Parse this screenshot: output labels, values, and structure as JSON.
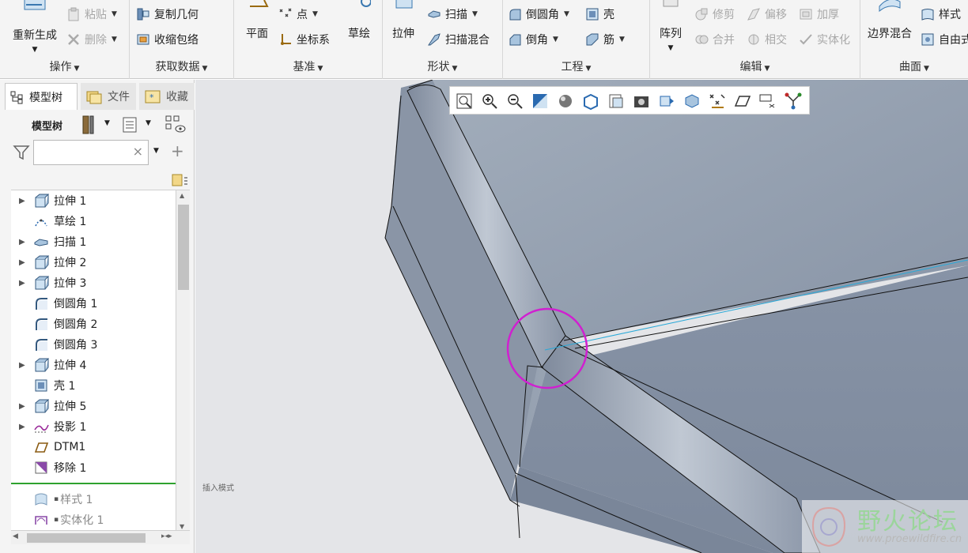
{
  "ribbon": {
    "operations": {
      "regenerate": "重新生成",
      "paste": "粘贴",
      "delete": "删除",
      "group_label": "操作"
    },
    "get_data": {
      "copy_geometry": "复制几何",
      "shrinkwrap": "收缩包络",
      "group_label": "获取数据"
    },
    "datum": {
      "plane": "平面",
      "point": "点",
      "csys": "坐标系",
      "sketch": "草绘",
      "group_label": "基准"
    },
    "shapes": {
      "extrude": "拉伸",
      "sweep": "扫描",
      "swept_blend": "扫描混合",
      "group_label": "形状"
    },
    "engineering": {
      "round": "倒圆角",
      "chamfer": "倒角",
      "shell": "壳",
      "rib": "筋",
      "group_label": "工程"
    },
    "editing": {
      "pattern": "阵列",
      "trim": "修剪",
      "offset": "偏移",
      "thicken": "加厚",
      "merge": "合并",
      "intersect": "相交",
      "solidify": "实体化",
      "group_label": "编辑"
    },
    "surfaces": {
      "boundary_blend": "边界混合",
      "style": "样式",
      "freestyle": "自由式",
      "group_label": "曲面"
    }
  },
  "left_panel": {
    "tabs": [
      {
        "label": "模型树"
      },
      {
        "label": "文件"
      },
      {
        "label": "收藏"
      }
    ],
    "toolbar_label": "模型树",
    "search": {
      "value": "",
      "clear": "×",
      "add": "+"
    },
    "tree_items": [
      {
        "label": "拉伸 1",
        "icon": "extrude-icon",
        "expandable": true
      },
      {
        "label": "草绘 1",
        "icon": "sketch-icon",
        "expandable": false
      },
      {
        "label": "扫描 1",
        "icon": "sweep-icon",
        "expandable": true
      },
      {
        "label": "拉伸 2",
        "icon": "extrude-icon",
        "expandable": true
      },
      {
        "label": "拉伸 3",
        "icon": "extrude-icon",
        "expandable": true
      },
      {
        "label": "倒圆角 1",
        "icon": "round-icon",
        "expandable": false
      },
      {
        "label": "倒圆角 2",
        "icon": "round-icon",
        "expandable": false
      },
      {
        "label": "倒圆角 3",
        "icon": "round-icon",
        "expandable": false
      },
      {
        "label": "拉伸 4",
        "icon": "extrude-icon",
        "expandable": true
      },
      {
        "label": "壳 1",
        "icon": "shell-icon",
        "expandable": false
      },
      {
        "label": "拉伸 5",
        "icon": "extrude-icon",
        "expandable": true
      },
      {
        "label": "投影 1",
        "icon": "projection-icon",
        "expandable": true
      },
      {
        "label": "DTM1",
        "icon": "datum-plane-icon",
        "expandable": false
      },
      {
        "label": "移除 1",
        "icon": "remove-icon",
        "expandable": false
      }
    ],
    "after_insert_items": [
      {
        "label": "样式 1",
        "icon": "style-icon"
      },
      {
        "label": "实体化 1",
        "icon": "solidify-icon"
      }
    ]
  },
  "viewport": {
    "insert_mode_label": "插入模式",
    "highlight_color": "#d020d0",
    "edge_highlight_color": "#29a9d8",
    "model_color": "#8e99aa"
  },
  "watermark": {
    "title": "野火论坛",
    "url": "www.proewildfire.cn"
  }
}
